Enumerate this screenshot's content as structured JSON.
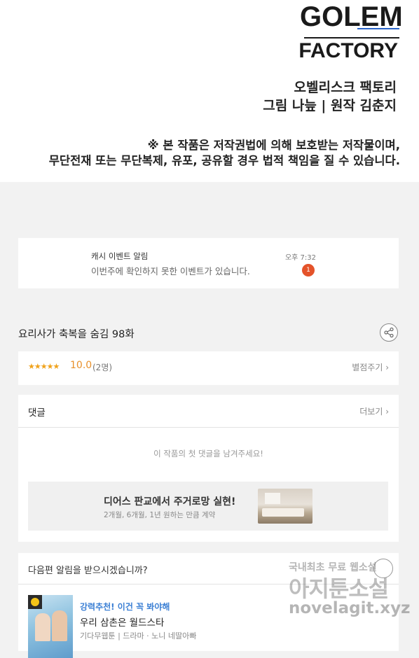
{
  "header": {
    "logo_line1": "GOLEM",
    "logo_line2": "FACTORY",
    "credit_line1": "오벨리스크 팩토리",
    "credit_line2": "그림 나늪 | 원작 김춘지",
    "notice_line1": "※ 본 작품은 저작권법에 의해 보호받는 저작물이며,",
    "notice_line2": "무단전재 또는 무단복제, 유포, 공유할 경우 법적 책임을 질 수 있습니다."
  },
  "notification": {
    "title": "캐시 이벤트 알림",
    "message": "이번주에 확인하지 못한 이벤트가 있습니다.",
    "time": "오후 7:32",
    "badge_count": "1"
  },
  "episode": {
    "title": "요리사가 축복을 숨김 98화",
    "share_icon": "share-icon"
  },
  "rating": {
    "stars": "★★★★★",
    "score": "10.0",
    "votes": "(2명)",
    "rate_link": "별점주기 ›",
    "star_color": "#f0a21b"
  },
  "comments": {
    "title": "댓글",
    "more_link": "더보기 ›",
    "empty_text": "이 작품의 첫 댓글을 남겨주세요!",
    "ad": {
      "title": "디어스 판교에서 주거로망 실현!",
      "subtitle": "2개월, 6개월, 1년 원하는 만큼 계약"
    }
  },
  "subscribe": {
    "question": "다음편 알림을 받으시겠습니까?",
    "recommend_tag": "강력추천! 이건 꼭 봐야해",
    "recommend_title": "우리 삼촌은 월드스타",
    "recommend_meta": "기다무웹툰 | 드라마 · 노니 네딸아빠",
    "accent_color": "#3b7fd4"
  },
  "watermark": {
    "line1": "국내최초 무료 웹소설",
    "line2": "아지툰소설",
    "line3": "novelagit.xyz"
  }
}
